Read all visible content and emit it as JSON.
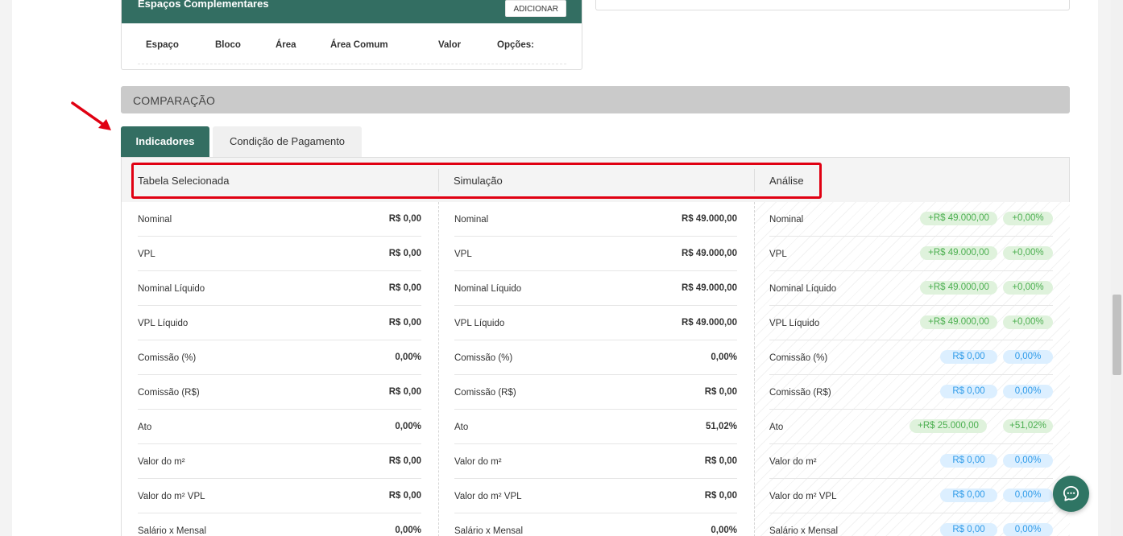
{
  "spaces": {
    "title": "Espaços Complementares",
    "add_button": "ADICIONAR",
    "columns": [
      "Espaço",
      "Bloco",
      "Área",
      "Área Comum",
      "Valor",
      "Opções:"
    ]
  },
  "section": {
    "title": "COMPARAÇÃO"
  },
  "tabs": [
    {
      "label": "Indicadores",
      "active": true
    },
    {
      "label": "Condição de Pagamento",
      "active": false
    }
  ],
  "headers": [
    "Tabela Selecionada",
    "Simulação",
    "Análise"
  ],
  "rows": [
    {
      "label": "Nominal",
      "tabela": "R$ 0,00",
      "simulacao": "R$ 49.000,00",
      "analise_valor": "+R$ 49.000,00",
      "analise_pct": "+0,00%",
      "status": "green"
    },
    {
      "label": "VPL",
      "tabela": "R$ 0,00",
      "simulacao": "R$ 49.000,00",
      "analise_valor": "+R$ 49.000,00",
      "analise_pct": "+0,00%",
      "status": "green"
    },
    {
      "label": "Nominal Líquido",
      "tabela": "R$ 0,00",
      "simulacao": "R$ 49.000,00",
      "analise_valor": "+R$ 49.000,00",
      "analise_pct": "+0,00%",
      "status": "green"
    },
    {
      "label": "VPL Líquido",
      "tabela": "R$ 0,00",
      "simulacao": "R$ 49.000,00",
      "analise_valor": "+R$ 49.000,00",
      "analise_pct": "+0,00%",
      "status": "green"
    },
    {
      "label": "Comissão (%)",
      "tabela": "0,00%",
      "simulacao": "0,00%",
      "analise_valor": "R$ 0,00",
      "analise_pct": "0,00%",
      "status": "blue"
    },
    {
      "label": "Comissão (R$)",
      "tabela": "R$ 0,00",
      "simulacao": "R$ 0,00",
      "analise_valor": "R$ 0,00",
      "analise_pct": "0,00%",
      "status": "blue"
    },
    {
      "label": "Ato",
      "tabela": "0,00%",
      "simulacao": "51,02%",
      "analise_valor": "+R$ 25.000,00",
      "analise_pct": "+51,02%",
      "status": "green"
    },
    {
      "label": "Valor do m²",
      "tabela": "R$ 0,00",
      "simulacao": "R$ 0,00",
      "analise_valor": "R$ 0,00",
      "analise_pct": "0,00%",
      "status": "blue"
    },
    {
      "label": "Valor do m² VPL",
      "tabela": "R$ 0,00",
      "simulacao": "R$ 0,00",
      "analise_valor": "R$ 0,00",
      "analise_pct": "0,00%",
      "status": "blue"
    },
    {
      "label": "Salário x Mensal",
      "tabela": "0,00%",
      "simulacao": "0,00%",
      "analise_valor": "R$ 0,00",
      "analise_pct": "0,00%",
      "status": "blue"
    }
  ],
  "colors": {
    "accent": "#336e62",
    "highlight": "#e00012",
    "positive": "#4caf50",
    "neutral": "#2f9be9"
  },
  "icons": {
    "chat": "chat-bubble-icon",
    "annotation": "red-arrow-icon"
  }
}
